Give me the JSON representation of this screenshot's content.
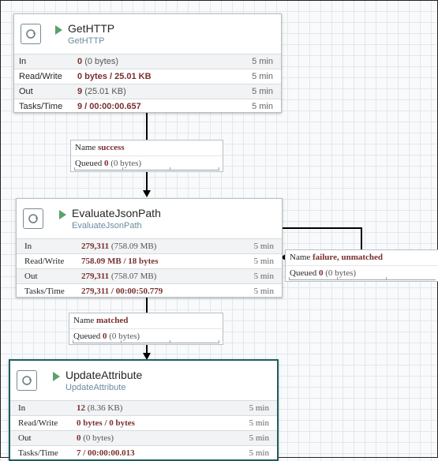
{
  "processors": [
    {
      "name": "GetHTTP",
      "type": "GetHTTP",
      "stats": [
        {
          "label": "In",
          "value": "0",
          "detail": "(0 bytes)",
          "time": "5 min"
        },
        {
          "label": "Read/Write",
          "value": "0 bytes / 25.01 KB",
          "detail": "",
          "time": "5 min"
        },
        {
          "label": "Out",
          "value": "9",
          "detail": "(25.01 KB)",
          "time": "5 min"
        },
        {
          "label": "Tasks/Time",
          "value": "9 / 00:00:00.657",
          "detail": "",
          "time": "5 min"
        }
      ]
    },
    {
      "name": "EvaluateJsonPath",
      "type": "EvaluateJsonPath",
      "stats": [
        {
          "label": "In",
          "value": "279,311",
          "detail": "(758.09 MB)",
          "time": "5 min"
        },
        {
          "label": "Read/Write",
          "value": "758.09 MB / 18 bytes",
          "detail": "",
          "time": "5 min"
        },
        {
          "label": "Out",
          "value": "279,311",
          "detail": "(758.07 MB)",
          "time": "5 min"
        },
        {
          "label": "Tasks/Time",
          "value": "279,311 / 00:00:50.779",
          "detail": "",
          "time": "5 min"
        }
      ]
    },
    {
      "name": "UpdateAttribute",
      "type": "UpdateAttribute",
      "stats": [
        {
          "label": "In",
          "value": "12",
          "detail": "(8.36 KB)",
          "time": "5 min"
        },
        {
          "label": "Read/Write",
          "value": "0 bytes / 0 bytes",
          "detail": "",
          "time": "5 min"
        },
        {
          "label": "Out",
          "value": "0",
          "detail": "(0 bytes)",
          "time": "5 min"
        },
        {
          "label": "Tasks/Time",
          "value": "7 / 00:00:00.013",
          "detail": "",
          "time": "5 min"
        }
      ]
    }
  ],
  "connections": [
    {
      "name_label": "Name",
      "name": "success",
      "queued_label": "Queued",
      "queued": "0",
      "queued_detail": "(0 bytes)"
    },
    {
      "name_label": "Name",
      "name": "matched",
      "queued_label": "Queued",
      "queued": "0",
      "queued_detail": "(0 bytes)"
    },
    {
      "name_label": "Name",
      "name": "failure, unmatched",
      "queued_label": "Queued",
      "queued": "0",
      "queued_detail": "(0 bytes)"
    }
  ]
}
